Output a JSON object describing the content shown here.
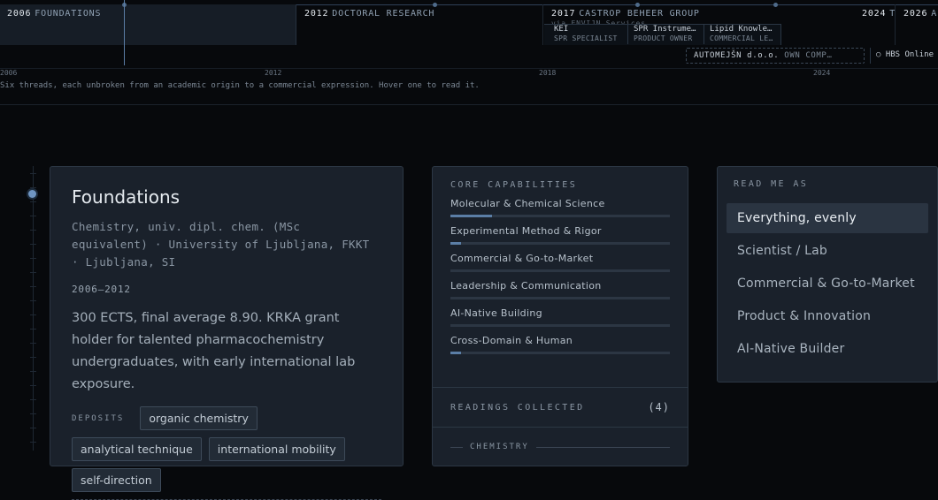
{
  "timeline": {
    "eras": [
      {
        "year": "2006",
        "label": "FOUNDATIONS"
      },
      {
        "year": "2012",
        "label": "DOCTORAL RESEARCH"
      },
      {
        "year": "2017",
        "label": "CASTROP BEHEER GROUP"
      },
      {
        "year": "2024",
        "label": "T"
      },
      {
        "year": "2026",
        "label": "A"
      }
    ],
    "castrop_note": "via ENVIJN Services",
    "sub_roles": [
      {
        "company": "KEI",
        "role": "SPR SPECIALIST"
      },
      {
        "company": "SPR Instrume…",
        "role": "PRODUCT OWNER"
      },
      {
        "company": "Lipid Knowle…",
        "role": "COMMERCIAL LE…"
      }
    ],
    "pill_auto": {
      "name": "AUTOMEJŠN d.o.o.",
      "role": "OWN COMP…"
    },
    "pill_hbs": "○ HBS Online",
    "axis": [
      "2006",
      "2012",
      "2018",
      "2024"
    ],
    "note": "Six threads, each unbroken from an academic origin to a commercial expression. Hover one to read it."
  },
  "detail": {
    "title": "Foundations",
    "subtitle": "Chemistry, univ. dipl. chem. (MSc equivalent) · University of Ljubljana, FKKT · Ljubljana, SI",
    "dates": "2006–2012",
    "body": "300 ECTS, final average 8.90. KRKA grant holder for talented pharmacochemistry undergraduates, with early international lab exposure.",
    "deposits_label": "DEPOSITS",
    "tags": [
      "organic chemistry",
      "analytical technique",
      "international mobility",
      "self-direction"
    ]
  },
  "core": {
    "header": "CORE CAPABILITIES",
    "items": [
      {
        "label": "Molecular & Chemical Science",
        "level": 0.19
      },
      {
        "label": "Experimental Method & Rigor",
        "level": 0.05
      },
      {
        "label": "Commercial & Go-to-Market",
        "level": 0
      },
      {
        "label": "Leadership & Communication",
        "level": 0
      },
      {
        "label": "AI-Native Building",
        "level": 0
      },
      {
        "label": "Cross-Domain & Human",
        "level": 0.05
      }
    ],
    "readings_label": "READINGS COLLECTED",
    "readings_count": "(4)",
    "group_label": "CHEMISTRY"
  },
  "read": {
    "header": "READ ME AS",
    "options": [
      "Everything, evenly",
      "Scientist / Lab",
      "Commercial & Go-to-Market",
      "Product & Innovation",
      "AI-Native Builder"
    ],
    "selected": 0
  },
  "colors": {
    "accent": "#5b7ea6",
    "background": "#07090c",
    "card": "#1a212b"
  }
}
